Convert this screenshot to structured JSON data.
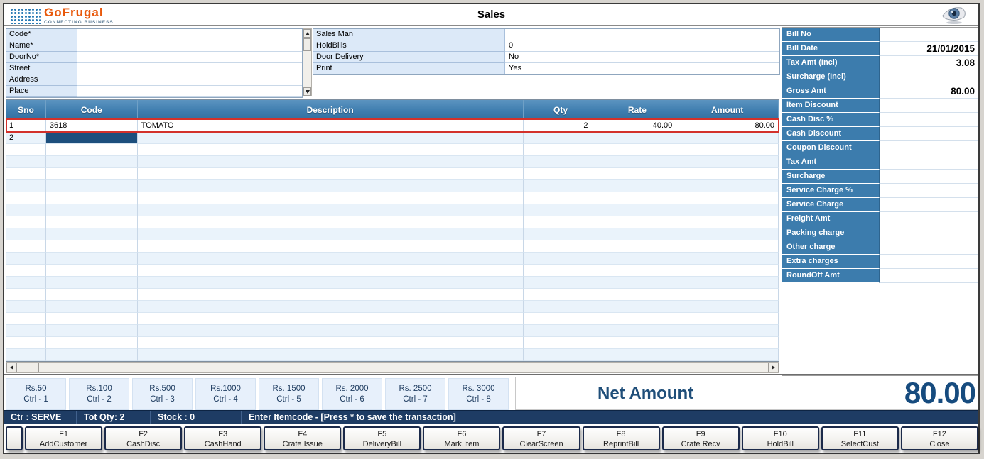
{
  "window": {
    "title": "Sales"
  },
  "logo": {
    "name": "GoFrugal",
    "tagline": "CONNECTING BUSINESS"
  },
  "customer_form": {
    "rows": [
      {
        "label": "Code*",
        "value": ""
      },
      {
        "label": "Name*",
        "value": ""
      },
      {
        "label": "DoorNo*",
        "value": ""
      },
      {
        "label": "Street",
        "value": ""
      },
      {
        "label": "Address",
        "value": ""
      },
      {
        "label": "Place",
        "value": ""
      }
    ]
  },
  "options_form": {
    "rows": [
      {
        "label": "Sales Man",
        "value": ""
      },
      {
        "label": "HoldBills",
        "value": "0"
      },
      {
        "label": "Door Delivery",
        "value": "No"
      },
      {
        "label": "Print",
        "value": "Yes"
      }
    ]
  },
  "bill_panel": {
    "rows": [
      {
        "label": "Bill No",
        "value": ""
      },
      {
        "label": "Bill Date",
        "value": "21/01/2015"
      },
      {
        "label": "Tax Amt (Incl)",
        "value": "3.08"
      },
      {
        "label": "Surcharge (Incl)",
        "value": ""
      },
      {
        "label": "Gross Amt",
        "value": "80.00"
      },
      {
        "label": "Item Discount",
        "value": ""
      },
      {
        "label": "Cash Disc %",
        "value": ""
      },
      {
        "label": "Cash Discount",
        "value": ""
      },
      {
        "label": "Coupon Discount",
        "value": ""
      },
      {
        "label": "Tax Amt",
        "value": ""
      },
      {
        "label": "Surcharge",
        "value": ""
      },
      {
        "label": "Service Charge %",
        "value": ""
      },
      {
        "label": "Service Charge",
        "value": ""
      },
      {
        "label": "Freight Amt",
        "value": ""
      },
      {
        "label": "Packing charge",
        "value": ""
      },
      {
        "label": "Other charge",
        "value": ""
      },
      {
        "label": "Extra charges",
        "value": ""
      },
      {
        "label": "RoundOff Amt",
        "value": ""
      }
    ]
  },
  "items_table": {
    "columns": [
      "Sno",
      "Code",
      "Description",
      "Qty",
      "Rate",
      "Amount"
    ],
    "rows": [
      {
        "sno": "1",
        "code": "3618",
        "description": "TOMATO",
        "qty": "2",
        "rate": "40.00",
        "amount": "80.00",
        "highlighted": true
      },
      {
        "sno": "2",
        "code": "",
        "description": "",
        "qty": "",
        "rate": "",
        "amount": "",
        "selected_cell": "code"
      }
    ],
    "empty_row_count": 18
  },
  "denominations": [
    {
      "amount": "Rs.50",
      "shortcut": "Ctrl - 1"
    },
    {
      "amount": "Rs.100",
      "shortcut": "Ctrl - 2"
    },
    {
      "amount": "Rs.500",
      "shortcut": "Ctrl - 3"
    },
    {
      "amount": "Rs.1000",
      "shortcut": "Ctrl - 4"
    },
    {
      "amount": "Rs. 1500",
      "shortcut": "Ctrl - 5"
    },
    {
      "amount": "Rs. 2000",
      "shortcut": "Ctrl - 6"
    },
    {
      "amount": "Rs. 2500",
      "shortcut": "Ctrl - 7"
    },
    {
      "amount": "Rs. 3000",
      "shortcut": "Ctrl - 8"
    }
  ],
  "net_amount": {
    "label": "Net Amount",
    "value": "80.00"
  },
  "status_bar": {
    "counter": "Ctr : SERVE",
    "total_qty": "Tot Qty: 2",
    "stock": "Stock : 0",
    "message": "Enter Itemcode - [Press * to save the transaction]"
  },
  "function_keys": [
    {
      "key": "F1",
      "label": "AddCustomer"
    },
    {
      "key": "F2",
      "label": "CashDisc"
    },
    {
      "key": "F3",
      "label": "CashHand"
    },
    {
      "key": "F4",
      "label": "Crate Issue"
    },
    {
      "key": "F5",
      "label": "DeliveryBill"
    },
    {
      "key": "F6",
      "label": "Mark.Item"
    },
    {
      "key": "F7",
      "label": "ClearScreen"
    },
    {
      "key": "F8",
      "label": "ReprintBill"
    },
    {
      "key": "F9",
      "label": "Crate Recv"
    },
    {
      "key": "F10",
      "label": "HoldBill"
    },
    {
      "key": "F11",
      "label": "SelectCust"
    },
    {
      "key": "F12",
      "label": "Close"
    }
  ],
  "colors": {
    "header_blue": "#3E7DAF",
    "panel_blue": "#3C7CAD",
    "status_navy": "#1E3C64",
    "selection_navy": "#1D4F7D",
    "highlight_red": "#D3312B",
    "net_blue": "#1F4E79",
    "logo_orange": "#E8590C",
    "row_stripe": "#EAF3FB"
  }
}
